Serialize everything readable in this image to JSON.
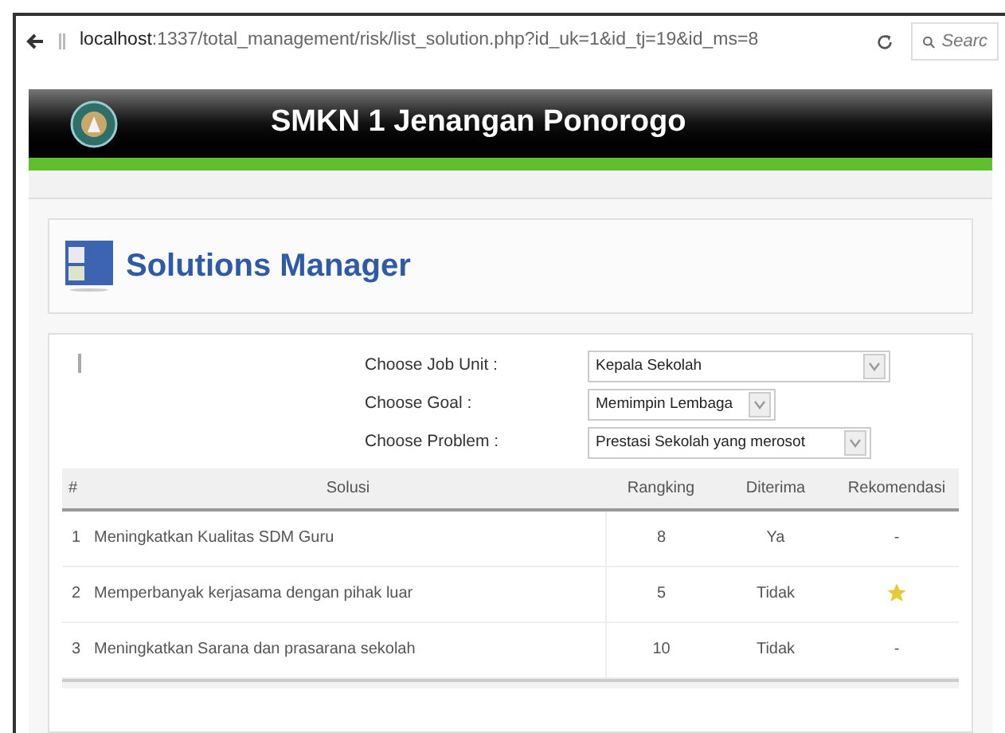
{
  "browser": {
    "url_host": "localhost",
    "url_path": ":1337/total_management/risk/list_solution.php?id_uk=1&id_tj=19&id_ms=8",
    "search_placeholder": "Searc"
  },
  "header": {
    "title": "SMKN 1 Jenangan Ponorogo"
  },
  "page_title": "Solutions Manager",
  "filters": [
    {
      "label": "Choose Job Unit :",
      "value": "Kepala Sekolah",
      "kind": "wide"
    },
    {
      "label": "Choose Goal :",
      "value": "Memimpin Lembaga",
      "kind": "short"
    },
    {
      "label": "Choose Problem :",
      "value": "Prestasi Sekolah yang merosot",
      "kind": "medium"
    }
  ],
  "table": {
    "columns": [
      "#",
      "Solusi",
      "Rangking",
      "Diterima",
      "Rekomendasi"
    ],
    "rows": [
      {
        "no": "1",
        "solusi": "Meningkatkan Kualitas SDM Guru",
        "rangking": "8",
        "diterima": "Ya",
        "recommended": false,
        "rekomendasi": "-"
      },
      {
        "no": "2",
        "solusi": "Memperbanyak kerjasama dengan pihak luar",
        "rangking": "5",
        "diterima": "Tidak",
        "recommended": true
      },
      {
        "no": "3",
        "solusi": "Meningkatkan Sarana dan prasarana sekolah",
        "rangking": "10",
        "diterima": "Tidak",
        "recommended": false,
        "rekomendasi": "-"
      }
    ]
  }
}
